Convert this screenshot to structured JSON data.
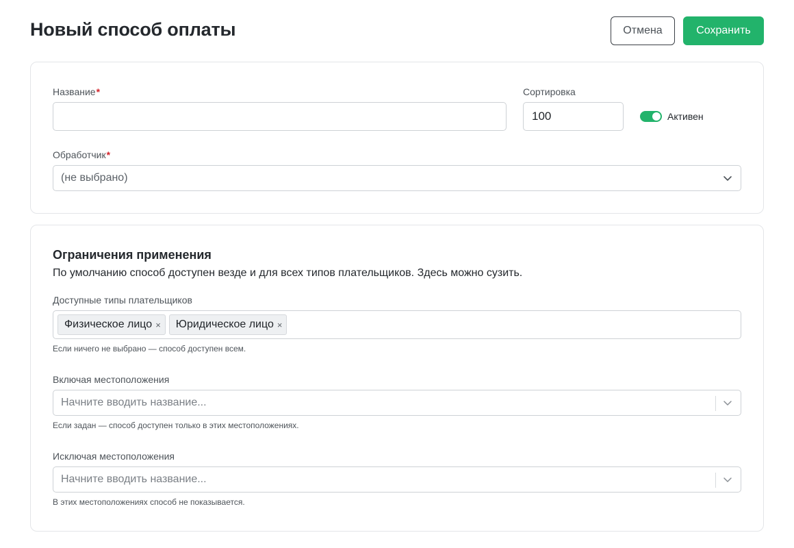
{
  "header": {
    "title": "Новый способ оплаты",
    "cancel_label": "Отмена",
    "save_label": "Сохранить"
  },
  "main_card": {
    "name_label": "Название",
    "name_value": "",
    "sort_label": "Сортировка",
    "sort_value": "100",
    "active_label": "Активен",
    "active_on": true,
    "handler_label": "Обработчик",
    "handler_value": "(не выбрано)",
    "required_mark": "*"
  },
  "restrictions": {
    "title": "Ограничения применения",
    "subtitle": "По умолчанию способ доступен везде и для всех типов плательщиков. Здесь можно сузить.",
    "payer_types_label": "Доступные типы плательщиков",
    "payer_types": [
      "Физическое лицо",
      "Юридическое лицо"
    ],
    "remove_glyph": "×",
    "payer_types_help": "Если ничего не выбрано — способ доступен всем.",
    "include_label": "Включая местоположения",
    "include_placeholder": "Начните вводить название...",
    "include_help": "Если задан — способ доступен только в этих местоположениях.",
    "exclude_label": "Исключая местоположения",
    "exclude_placeholder": "Начните вводить название...",
    "exclude_help": "В этих местоположениях способ не показывается."
  },
  "colors": {
    "accent": "#22b36b",
    "required": "#d2232a",
    "border": "#cdd1d5"
  }
}
